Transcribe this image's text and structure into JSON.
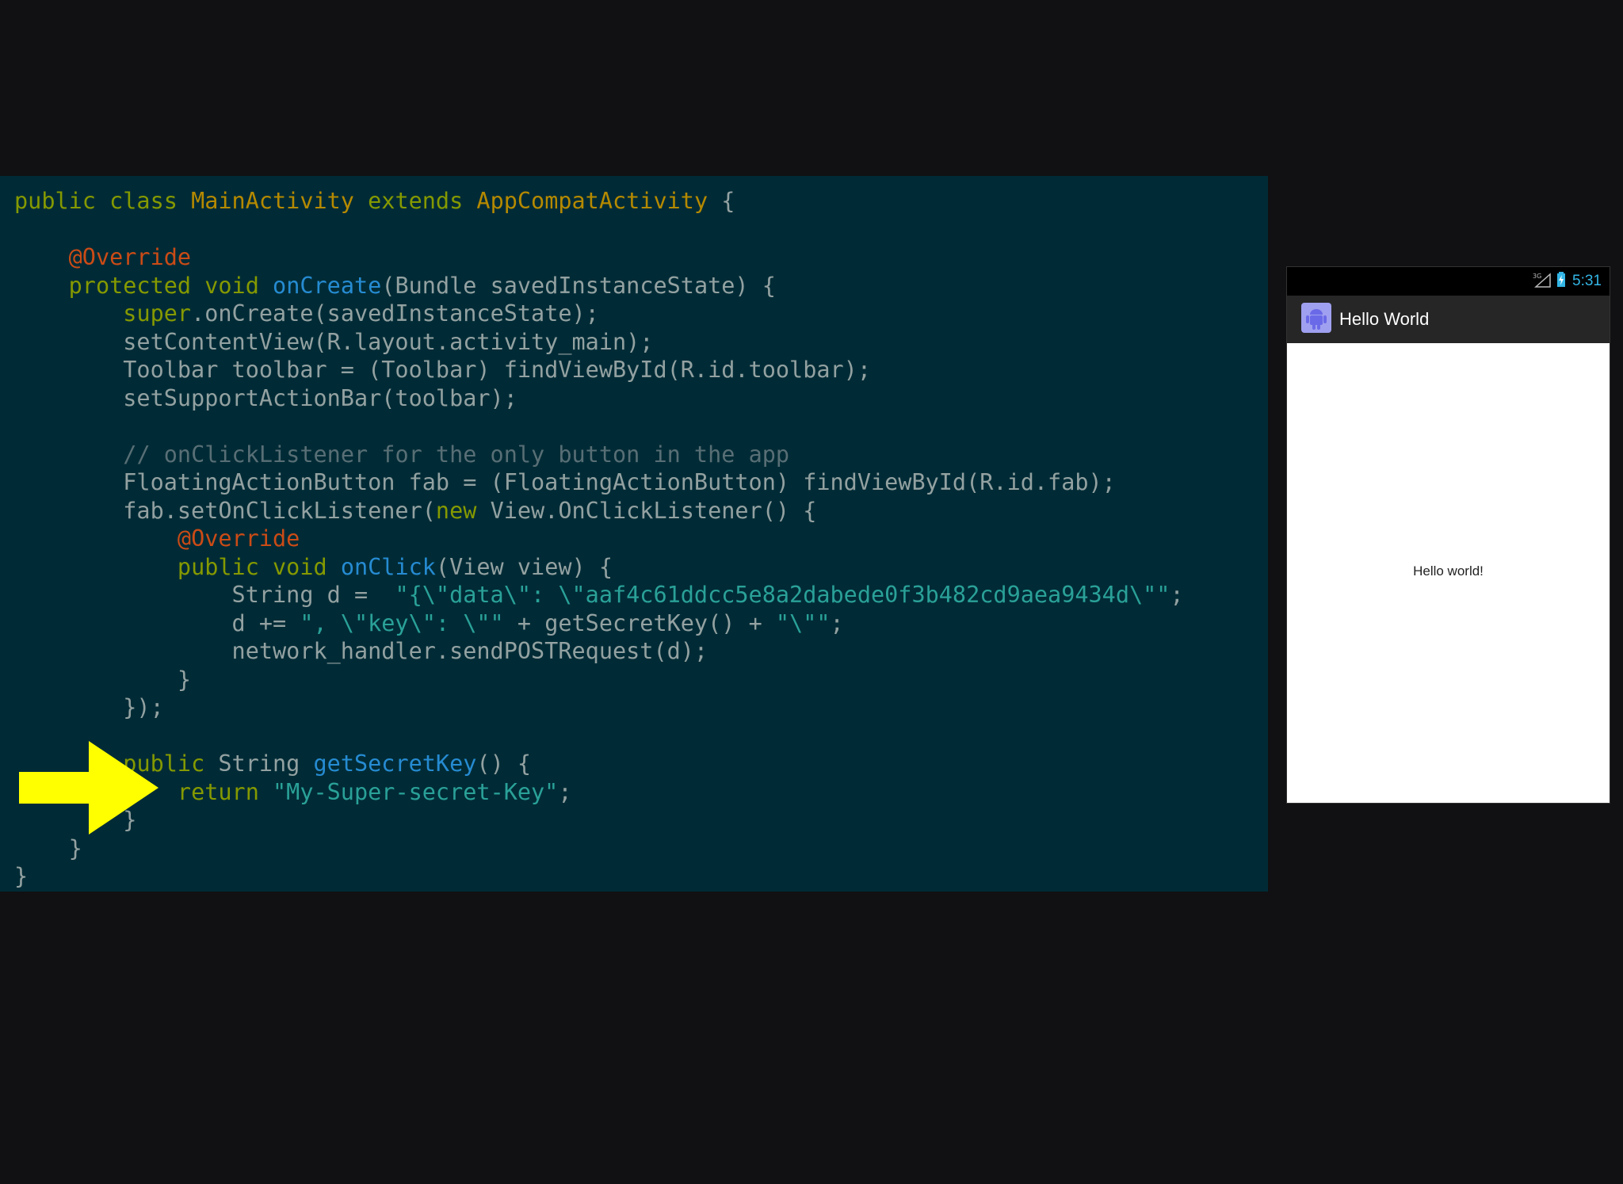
{
  "code": {
    "lines": [
      [
        {
          "c": "kw",
          "t": "public class "
        },
        {
          "c": "ty",
          "t": "MainActivity "
        },
        {
          "c": "kw",
          "t": "extends "
        },
        {
          "c": "ty",
          "t": "AppCompatActivity"
        },
        {
          "c": "",
          "t": " {"
        }
      ],
      [],
      [
        {
          "c": "",
          "t": "    "
        },
        {
          "c": "an",
          "t": "@Override"
        }
      ],
      [
        {
          "c": "",
          "t": "    "
        },
        {
          "c": "kw",
          "t": "protected void "
        },
        {
          "c": "fn",
          "t": "onCreate"
        },
        {
          "c": "",
          "t": "(Bundle savedInstanceState) {"
        }
      ],
      [
        {
          "c": "",
          "t": "        "
        },
        {
          "c": "kw",
          "t": "super"
        },
        {
          "c": "",
          "t": ".onCreate(savedInstanceState);"
        }
      ],
      [
        {
          "c": "",
          "t": "        setContentView(R.layout.activity_main);"
        }
      ],
      [
        {
          "c": "",
          "t": "        Toolbar toolbar = (Toolbar) findViewById(R.id.toolbar);"
        }
      ],
      [
        {
          "c": "",
          "t": "        setSupportActionBar(toolbar);"
        }
      ],
      [],
      [
        {
          "c": "",
          "t": "        "
        },
        {
          "c": "cm",
          "t": "// onClickListener for the only button in the app"
        }
      ],
      [
        {
          "c": "",
          "t": "        FloatingActionButton fab = (FloatingActionButton) findViewById(R.id.fab);"
        }
      ],
      [
        {
          "c": "",
          "t": "        fab.setOnClickListener("
        },
        {
          "c": "kw",
          "t": "new"
        },
        {
          "c": "",
          "t": " View.OnClickListener() {"
        }
      ],
      [
        {
          "c": "",
          "t": "            "
        },
        {
          "c": "an",
          "t": "@Override"
        }
      ],
      [
        {
          "c": "",
          "t": "            "
        },
        {
          "c": "kw",
          "t": "public void "
        },
        {
          "c": "fn",
          "t": "onClick"
        },
        {
          "c": "",
          "t": "(View view) {"
        }
      ],
      [
        {
          "c": "",
          "t": "                String d =  "
        },
        {
          "c": "st",
          "t": "\"{\\\"data\\\": \\\"aaf4c61ddcc5e8a2dabede0f3b482cd9aea9434d\\\"\""
        },
        {
          "c": "",
          "t": ";"
        }
      ],
      [
        {
          "c": "",
          "t": "                d += "
        },
        {
          "c": "st",
          "t": "\", \\\"key\\\": \\\"\""
        },
        {
          "c": "",
          "t": " + getSecretKey() + "
        },
        {
          "c": "st",
          "t": "\"\\\"\""
        },
        {
          "c": "",
          "t": ";"
        }
      ],
      [
        {
          "c": "",
          "t": "                network_handler.sendPOSTRequest(d);"
        }
      ],
      [
        {
          "c": "",
          "t": "            }"
        }
      ],
      [
        {
          "c": "",
          "t": "        });"
        }
      ],
      [],
      [
        {
          "c": "",
          "t": "        "
        },
        {
          "c": "kw",
          "t": "public "
        },
        {
          "c": "",
          "t": "String "
        },
        {
          "c": "fn",
          "t": "getSecretKey"
        },
        {
          "c": "",
          "t": "() {"
        }
      ],
      [
        {
          "c": "",
          "t": "            "
        },
        {
          "c": "kw",
          "t": "return "
        },
        {
          "c": "st",
          "t": "\"My-Super-secret-Key\""
        },
        {
          "c": "",
          "t": ";"
        }
      ],
      [
        {
          "c": "",
          "t": "        }"
        }
      ],
      [
        {
          "c": "",
          "t": "    }"
        }
      ],
      [
        {
          "c": "",
          "t": "}"
        }
      ]
    ]
  },
  "colors": {
    "code_background": "#002b36",
    "keyword": "#859900",
    "type": "#b58900",
    "annotation": "#cb4b16",
    "function": "#268bd2",
    "string": "#2aa198",
    "comment": "#586e75",
    "arrow": "#ffff00"
  },
  "phone": {
    "status_bar": {
      "signal_label": "3G",
      "time": "5:31"
    },
    "action_bar": {
      "title": "Hello World",
      "icon": "android-icon"
    },
    "content": {
      "text": "Hello world!"
    }
  }
}
